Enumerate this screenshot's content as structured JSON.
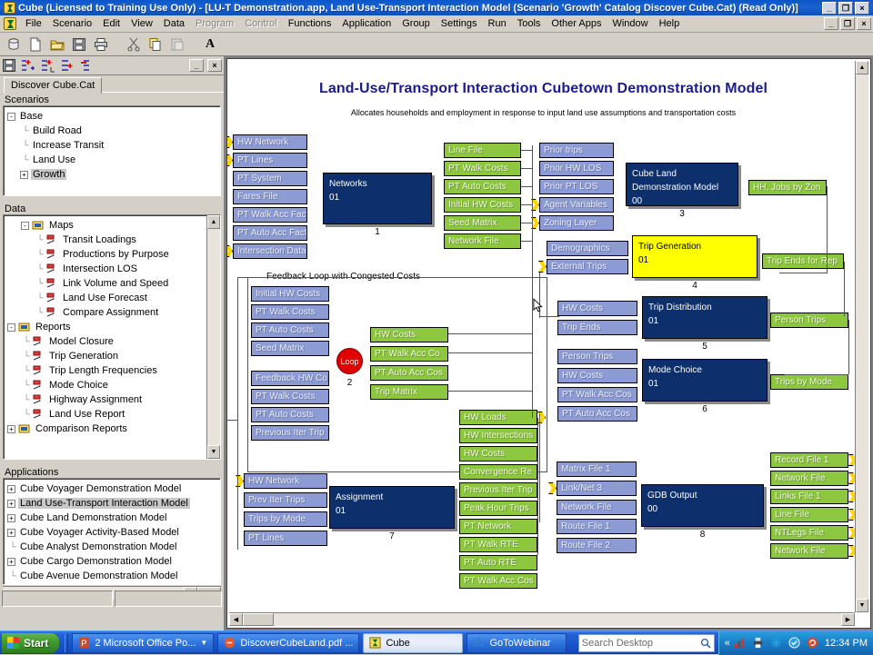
{
  "window": {
    "title": "Cube (Licensed to Training Use Only) - [LU-T Demonstration.app, Land Use-Transport Interaction Model (Scenario 'Growth' Catalog Discover Cube.Cat) (Read Only)]",
    "minimize_label": "_",
    "restore_label": "❐",
    "close_label": "×"
  },
  "menubar": {
    "items": [
      {
        "label": "File",
        "disabled": false
      },
      {
        "label": "Scenario",
        "disabled": false
      },
      {
        "label": "Edit",
        "disabled": false
      },
      {
        "label": "View",
        "disabled": false
      },
      {
        "label": "Data",
        "disabled": false
      },
      {
        "label": "Program",
        "disabled": true
      },
      {
        "label": "Control",
        "disabled": true
      },
      {
        "label": "Functions",
        "disabled": false
      },
      {
        "label": "Application",
        "disabled": false
      },
      {
        "label": "Group",
        "disabled": false
      },
      {
        "label": "Settings",
        "disabled": false
      },
      {
        "label": "Run",
        "disabled": false
      },
      {
        "label": "Tools",
        "disabled": false
      },
      {
        "label": "Other Apps",
        "disabled": false
      },
      {
        "label": "Window",
        "disabled": false
      },
      {
        "label": "Help",
        "disabled": false
      }
    ],
    "minimize_label": "_",
    "restore_label": "❐",
    "close_label": "×"
  },
  "toolbar": {
    "buttons": [
      {
        "name": "database-icon"
      },
      {
        "name": "new-file-icon"
      },
      {
        "name": "open-folder-icon"
      },
      {
        "name": "save-icon"
      },
      {
        "name": "print-icon"
      },
      {
        "name": "cut-icon"
      },
      {
        "name": "copy-icon"
      },
      {
        "name": "paste-icon"
      },
      {
        "name": "font-icon",
        "label": "A"
      }
    ]
  },
  "dock": {
    "tab_label": "Discover Cube.Cat",
    "minimize_label": "_",
    "close_label": "×",
    "scenarios": {
      "group_label": "Scenarios",
      "items": [
        {
          "label": "Base",
          "level": 0,
          "expander": "-",
          "selected": false
        },
        {
          "label": "Build Road",
          "level": 1,
          "expander": "",
          "selected": false
        },
        {
          "label": "Increase Transit",
          "level": 1,
          "expander": "",
          "selected": false
        },
        {
          "label": "Land Use",
          "level": 1,
          "expander": "",
          "selected": false
        },
        {
          "label": "Growth",
          "level": 1,
          "expander": "+",
          "selected": true
        }
      ]
    },
    "data": {
      "group_label": "Data",
      "items": [
        {
          "label": "Maps",
          "level": 1,
          "expander": "-",
          "icon": "folder-icon"
        },
        {
          "label": "Transit Loadings",
          "level": 2,
          "expander": "",
          "icon": "map-icon"
        },
        {
          "label": "Productions by Purpose",
          "level": 2,
          "expander": "",
          "icon": "map-icon"
        },
        {
          "label": "Intersection LOS",
          "level": 2,
          "expander": "",
          "icon": "map-icon"
        },
        {
          "label": "Link Volume and Speed",
          "level": 2,
          "expander": "",
          "icon": "map-icon"
        },
        {
          "label": "Land Use Forecast",
          "level": 2,
          "expander": "",
          "icon": "map-icon"
        },
        {
          "label": "Compare Assignment",
          "level": 2,
          "expander": "",
          "icon": "map-icon"
        },
        {
          "label": "Reports",
          "level": 0,
          "expander": "-",
          "icon": "folder-icon"
        },
        {
          "label": "Model Closure",
          "level": 1,
          "expander": "",
          "icon": "report-icon"
        },
        {
          "label": "Trip Generation",
          "level": 1,
          "expander": "",
          "icon": "report-icon"
        },
        {
          "label": "Trip Length Frequencies",
          "level": 1,
          "expander": "",
          "icon": "report-icon"
        },
        {
          "label": "Mode Choice",
          "level": 1,
          "expander": "",
          "icon": "report-icon"
        },
        {
          "label": "Highway Assignment",
          "level": 1,
          "expander": "",
          "icon": "report-icon"
        },
        {
          "label": "Land Use Report",
          "level": 1,
          "expander": "",
          "icon": "report-icon"
        },
        {
          "label": "Comparison Reports",
          "level": 0,
          "expander": "+",
          "icon": "folder-icon"
        }
      ]
    },
    "applications": {
      "group_label": "Applications",
      "items": [
        {
          "label": "Cube Voyager Demonstration Model",
          "expander": "+",
          "selected": false
        },
        {
          "label": "Land Use-Transport Interaction Model",
          "expander": "+",
          "selected": true
        },
        {
          "label": "Cube Land Demonstration Model",
          "expander": "+",
          "selected": false
        },
        {
          "label": "Cube Voyager Activity-Based Model",
          "expander": "+",
          "selected": false
        },
        {
          "label": "Cube Analyst Demonstration Model",
          "expander": "",
          "selected": false
        },
        {
          "label": "Cube Cargo Demonstration Model",
          "expander": "+",
          "selected": false
        },
        {
          "label": "Cube Avenue Demonstration Model",
          "expander": "",
          "selected": false
        }
      ]
    }
  },
  "diagram": {
    "title": "Land-Use/Transport Interaction Cubetown Demonstration Model",
    "subtitle": "Allocates households and employment in response to input land use assumptions and transportation costs",
    "group_label": "Feedback Loop with Congested Costs",
    "loop": {
      "label": "Loop",
      "number": "2"
    },
    "processes": [
      {
        "name": "Networks",
        "version": "01",
        "number": "1",
        "color": "blue"
      },
      {
        "name": "Cube Land Demonstration Model",
        "version": "00",
        "number": "3",
        "color": "blue"
      },
      {
        "name": "Trip Generation",
        "version": "01",
        "number": "4",
        "color": "yellow"
      },
      {
        "name": "Trip Distribution",
        "version": "01",
        "number": "5",
        "color": "blue"
      },
      {
        "name": "Mode Choice",
        "version": "01",
        "number": "6",
        "color": "blue"
      },
      {
        "name": "Assignment",
        "version": "01",
        "number": "7",
        "color": "blue"
      },
      {
        "name": "GDB Output",
        "version": "00",
        "number": "8",
        "color": "blue"
      }
    ],
    "inputs_networks": [
      "HW Network",
      "PT Lines",
      "PT System",
      "Fares File",
      "PT Walk Acc Fact",
      "PT Auto Acc Fact",
      "Intersection Data"
    ],
    "outputs_networks": [
      "Line File",
      "PT Walk Costs",
      "PT Auto Costs",
      "Initial HW Costs",
      "Seed Matrix",
      "Network File"
    ],
    "inputs_cubeland": [
      "Prior trips",
      "Prior HW LOS",
      "Prior PT LOS",
      "Agent Variables",
      "Zoning Layer"
    ],
    "outputs_cubeland": [
      "HH, Jobs by Zon"
    ],
    "inputs_tripgen": [
      "Demographics",
      "External Trips"
    ],
    "outputs_tripgen": [
      "Trip Ends for Rep"
    ],
    "inputs_loop_a": [
      "Initial HW Costs",
      "PT Walk Costs",
      "PT Auto Costs",
      "Seed Matrix"
    ],
    "inputs_loop_b": [
      "Feedback HW Co",
      "PT Walk Costs",
      "PT Auto Costs",
      "Previous Iter Trip"
    ],
    "outputs_loop": [
      "HW Costs",
      "PT Walk Acc Co",
      "PT Auto Acc Cos",
      "Trip Matrix"
    ],
    "inputs_tripdist": [
      "HW Costs",
      "Trip Ends"
    ],
    "outputs_tripdist": [
      "Person Trips"
    ],
    "inputs_modechoice": [
      "Person Trips",
      "HW Costs",
      "PT Walk Acc Cos",
      "PT Auto Acc Cos"
    ],
    "outputs_modechoice": [
      "Trips by Mode"
    ],
    "inputs_assignment": [
      "HW Network",
      "Prev Iter Trips",
      "Trips by Mode",
      "PT Lines"
    ],
    "outputs_assignment": [
      "HW Loads",
      "HW Intersections",
      "HW Costs",
      "Convergence Re",
      "Previous Iter Trip",
      "Peak Hour Trips",
      "PT Network",
      "PT Walk RTE",
      "PT Auto RTE",
      "PT Walk Acc Cos"
    ],
    "inputs_gdb": [
      "Matrix File 1",
      "Link/Net 3",
      "Network File",
      "Route File 1",
      "Route File 2"
    ],
    "outputs_gdb": [
      "Record File 1",
      "Network File",
      "Links File 1",
      "Line File",
      "NTLegs File",
      "Network File"
    ],
    "colors": {
      "input": "#8c9bd4",
      "output": "#8dc63f",
      "process": "#0d2f6b",
      "process_highlight": "#ffff00",
      "loop": "#e00000",
      "title": "#1b1b8f"
    }
  },
  "taskbar": {
    "start_label": "Start",
    "items": [
      {
        "label": "2 Microsoft Office Po...",
        "active": false,
        "icon": "powerpoint-icon",
        "has_chevron": true
      },
      {
        "label": "DiscoverCubeLand.pdf ...",
        "active": false,
        "icon": "pdf-icon",
        "has_chevron": false
      },
      {
        "label": "Cube",
        "active": true,
        "icon": "cube-icon",
        "has_chevron": false
      },
      {
        "label": "GoToWebinar",
        "active": false,
        "icon": "gotowebinar-icon",
        "has_chevron": false
      }
    ],
    "search_placeholder": "Search Desktop",
    "tray_expand": "«",
    "clock": "12:34 PM",
    "tray_icons": [
      "network-icon",
      "printer-icon",
      "snowflake-icon",
      "shield-icon",
      "sync-icon"
    ]
  }
}
